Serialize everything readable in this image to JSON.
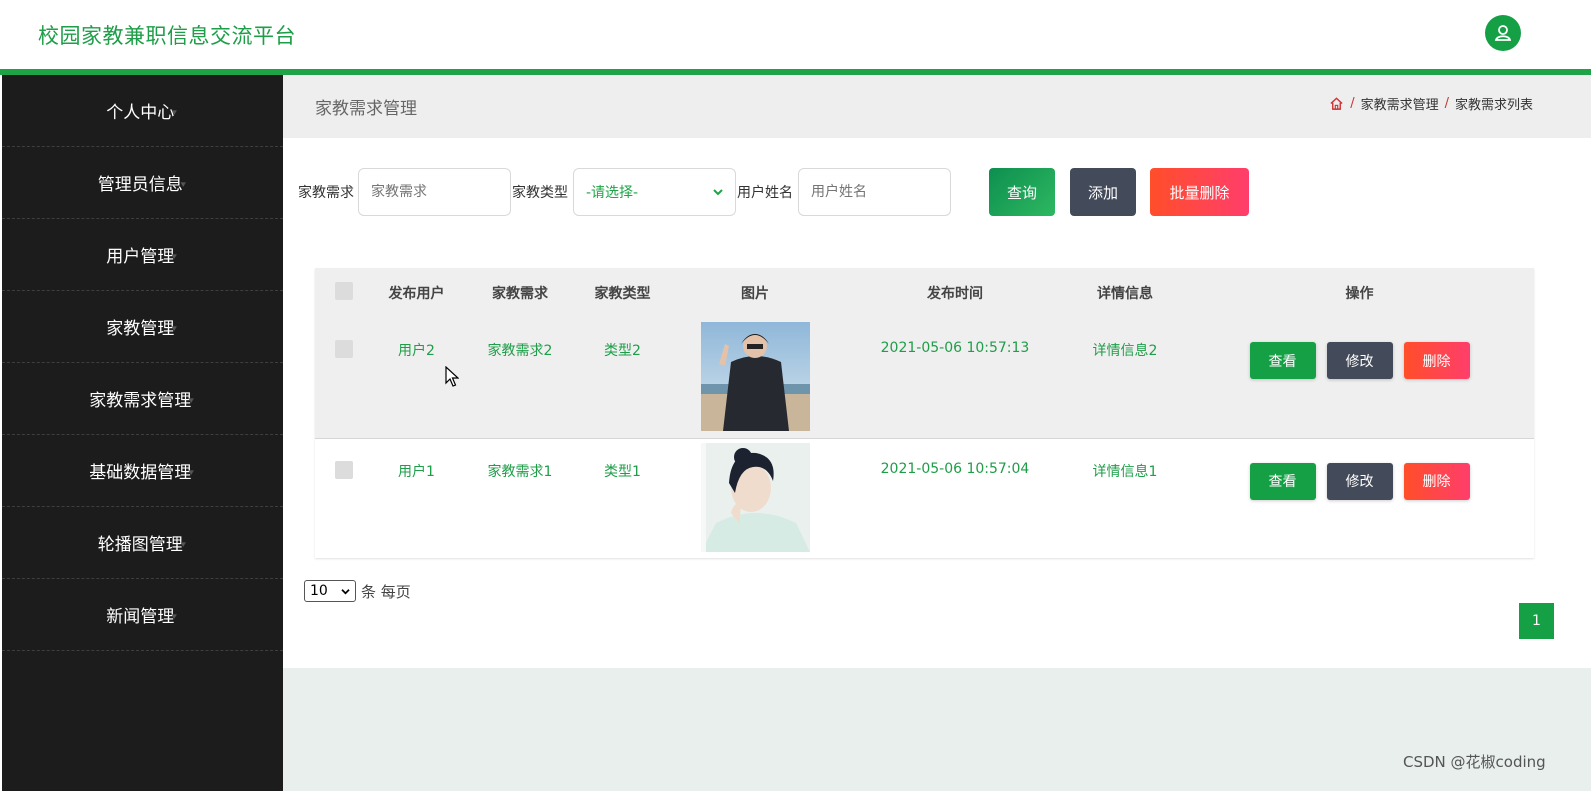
{
  "app": {
    "title": "校园家教兼职信息交流平台",
    "accent": "#1fa347"
  },
  "header": {
    "avatar_icon": "user-icon"
  },
  "sidebar": {
    "items": [
      {
        "label": "个人中心"
      },
      {
        "label": "管理员信息"
      },
      {
        "label": "用户管理"
      },
      {
        "label": "家教管理"
      },
      {
        "label": "家教需求管理"
      },
      {
        "label": "基础数据管理"
      },
      {
        "label": "轮播图管理"
      },
      {
        "label": "新闻管理"
      }
    ]
  },
  "page": {
    "title": "家教需求管理",
    "breadcrumb": [
      "家教需求管理",
      "家教需求列表"
    ],
    "breadcrumb_sep": "/"
  },
  "search": {
    "demand_label": "家教需求",
    "demand_placeholder": "家教需求",
    "type_label": "家教类型",
    "type_selected": "-请选择-",
    "username_label": "用户姓名",
    "username_placeholder": "用户姓名",
    "query_label": "查询",
    "add_label": "添加",
    "batch_delete_label": "批量删除"
  },
  "table": {
    "columns": [
      "发布用户",
      "家教需求",
      "家教类型",
      "图片",
      "发布时间",
      "详情信息",
      "操作"
    ],
    "rows": [
      {
        "user": "用户2",
        "demand": "家教需求2",
        "type": "类型2",
        "time": "2021-05-06 10:57:13",
        "detail": "详情信息2"
      },
      {
        "user": "用户1",
        "demand": "家教需求1",
        "type": "类型1",
        "time": "2021-05-06 10:57:04",
        "detail": "详情信息1"
      }
    ],
    "view_label": "查看",
    "edit_label": "修改",
    "delete_label": "删除"
  },
  "pagination": {
    "page_size": "10",
    "per_page_text": "条 每页",
    "current_page": "1"
  },
  "watermark": "CSDN @花椒coding",
  "colors": {
    "view": "#15a046",
    "edit": "#434a59",
    "delete": "#ff4a4a",
    "query": "#1a9a55"
  }
}
